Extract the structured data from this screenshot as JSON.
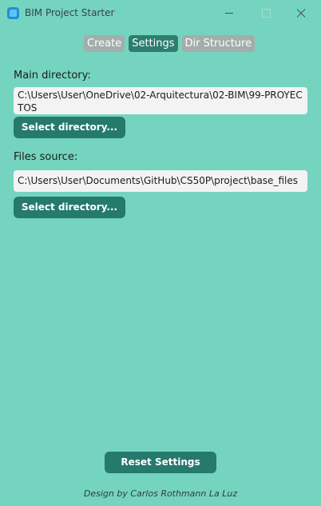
{
  "window": {
    "title": "BIM Project Starter"
  },
  "tabs": [
    {
      "label": "Create",
      "active": false
    },
    {
      "label": "Settings",
      "active": true
    },
    {
      "label": "Dir Structure",
      "active": false
    }
  ],
  "main_directory": {
    "label": "Main directory:",
    "value": "C:\\Users\\User\\OneDrive\\02-Arquitectura\\02-BIM\\99-PROYECTOS",
    "button_label": "Select directory..."
  },
  "files_source": {
    "label": "Files source:",
    "value": "C:\\Users\\User\\Documents\\GitHub\\CS50P\\project\\base_files",
    "button_label": "Select directory..."
  },
  "reset_button_label": "Reset Settings",
  "footer_text": "Design by Carlos Rothmann La Luz",
  "colors": {
    "background": "#74d4bf",
    "accent": "#257a6c",
    "tab_inactive": "#a3adab"
  }
}
